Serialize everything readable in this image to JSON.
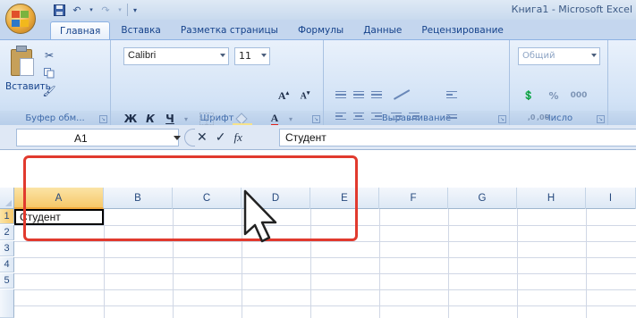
{
  "window": {
    "title": "Книга1 - Microsoft Excel"
  },
  "tabs": [
    {
      "label": "Главная",
      "active": true
    },
    {
      "label": "Вставка",
      "active": false
    },
    {
      "label": "Разметка страницы",
      "active": false
    },
    {
      "label": "Формулы",
      "active": false
    },
    {
      "label": "Данные",
      "active": false
    },
    {
      "label": "Рецензирование",
      "active": false
    }
  ],
  "ribbon": {
    "clipboard": {
      "paste_label": "Вставить",
      "group_label": "Буфер обм..."
    },
    "font": {
      "font_name": "Calibri",
      "font_size": "11",
      "group_label": "Шрифт",
      "bold": "Ж",
      "italic": "К",
      "underline": "Ч"
    },
    "alignment": {
      "group_label": "Выравнивание"
    },
    "number": {
      "format": "Общий",
      "percent": "%",
      "thousands": "000",
      "dec_inc": ",0 ,00",
      "group_label": "Число"
    }
  },
  "formula_bar": {
    "name_box": "A1",
    "cancel": "✕",
    "enter": "✓",
    "fx": "fx",
    "content": "Студент"
  },
  "sheet": {
    "columns": [
      "A",
      "B",
      "C",
      "D",
      "E",
      "F",
      "G",
      "H",
      "I"
    ],
    "rows": [
      "1",
      "2",
      "3",
      "4",
      "5"
    ],
    "active_cell_value": "Студент"
  },
  "colors": {
    "highlight": "#e13a2e",
    "ribbon_accent": "#15428b"
  }
}
